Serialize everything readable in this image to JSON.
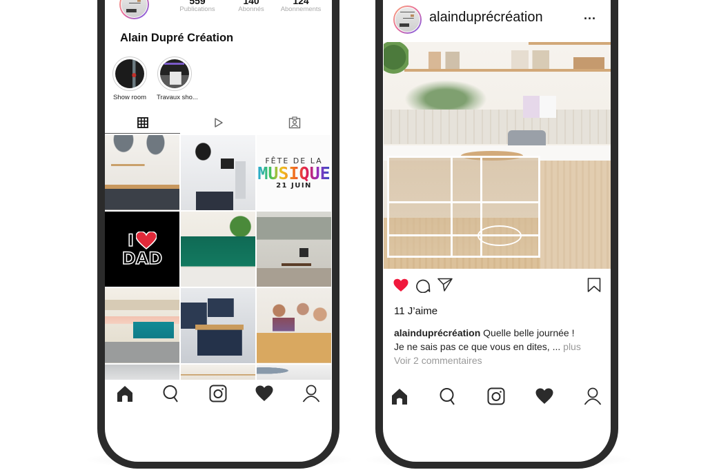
{
  "profile_screen": {
    "stats": [
      {
        "value": "559",
        "label": "Publications"
      },
      {
        "value": "140",
        "label": "Abonnés"
      },
      {
        "value": "124",
        "label": "Abonnements"
      }
    ],
    "display_name": "Alain Dupré Création",
    "highlights": [
      {
        "label": "Show room"
      },
      {
        "label": "Travaux sho..."
      }
    ],
    "tabs": [
      {
        "name": "grid",
        "icon": "grid-icon",
        "active": true
      },
      {
        "name": "reels",
        "icon": "play-icon",
        "active": false
      },
      {
        "name": "tagged",
        "icon": "tagged-user-icon",
        "active": false
      }
    ],
    "grid_posts": [
      {
        "description": "kitchen with island and pendant lamps"
      },
      {
        "description": "white kitchen with black pendant"
      },
      {
        "description": "Fête de la Musique poster",
        "text_line1": "FÊTE DE LA",
        "text_line2": "MUSIQUE",
        "text_line3": "21 JUIN"
      },
      {
        "description": "I love Dad graphic",
        "text_line1": "I",
        "text_line2": "DAD"
      },
      {
        "description": "kitchen with green tiles"
      },
      {
        "description": "open kitchen dining room"
      },
      {
        "description": "teal kitchen"
      },
      {
        "description": "navy blue kitchen island"
      },
      {
        "description": "family dinner"
      },
      {
        "description": "ceiling"
      },
      {
        "description": "kitchen shelves"
      },
      {
        "description": "white kitchen pendant"
      }
    ],
    "bottom_nav": [
      "home-icon",
      "search-icon",
      "instagram-camera-icon",
      "heart-icon",
      "profile-icon"
    ]
  },
  "post_screen": {
    "username": "alainduprécréation",
    "more_label": "...",
    "image_description": "Light wood kitchen island with white shelving",
    "actions": [
      "heart-filled-icon",
      "comment-icon",
      "share-icon",
      "bookmark-icon"
    ],
    "likes_text": "11 J’aime",
    "caption_user": "alainduprécréation",
    "caption_text_line1": " Quelle belle journée !",
    "caption_text_line2": "Je ne sais pas ce que vous en dites, ... ",
    "more_link": "plus",
    "view_comments": "Voir 2 commentaires",
    "bottom_nav": [
      "home-icon",
      "search-icon",
      "instagram-camera-icon",
      "heart-icon",
      "profile-icon"
    ]
  },
  "colors": {
    "phone_frame": "#2b2b2b",
    "like_red": "#f0183c",
    "icon_dark": "#2b2b2b",
    "muted_text": "#999999"
  }
}
